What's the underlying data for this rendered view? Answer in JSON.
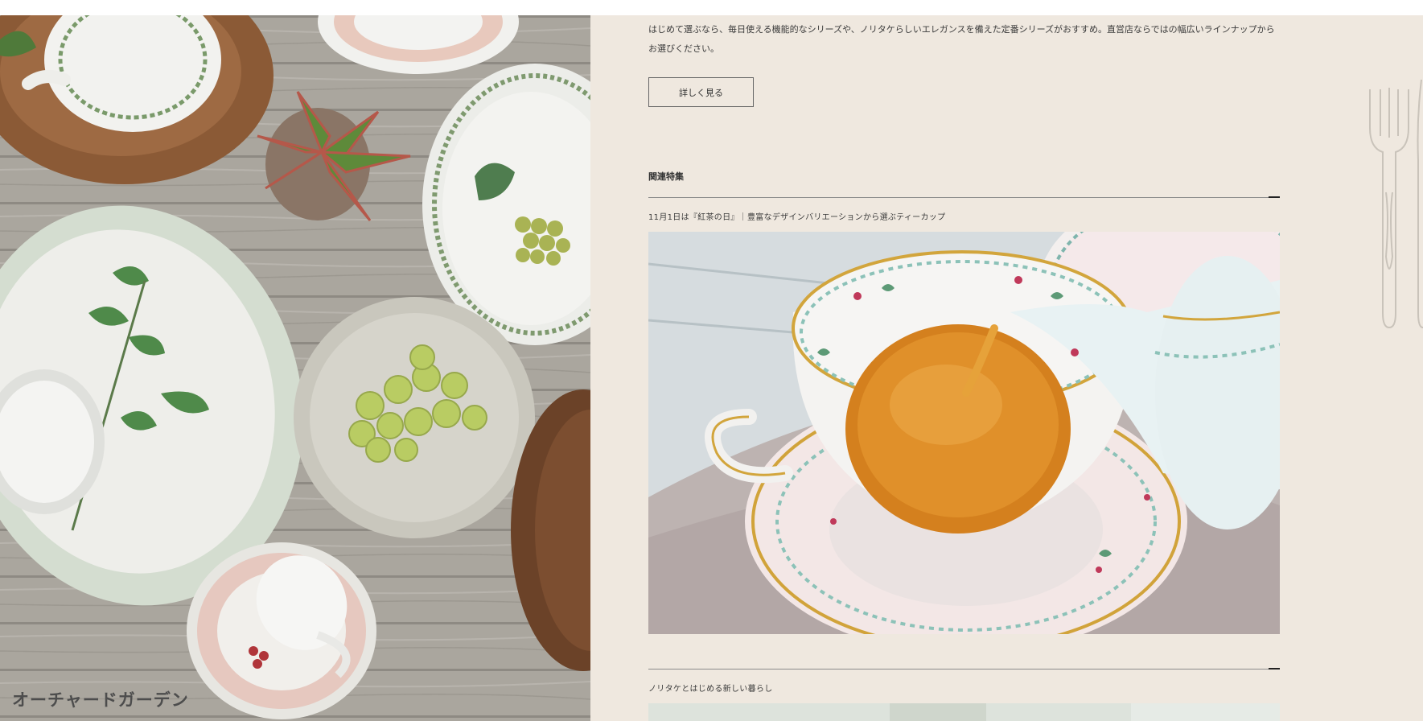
{
  "left_photo": {
    "series_name": "オーチャードガーデン"
  },
  "main": {
    "intro_text": "はじめて選ぶなら、毎日使える機能的なシリーズや、ノリタケらしいエレガンスを備えた定番シリーズがおすすめ。直営店ならではの幅広いラインナップからお選びください。",
    "more_button_label": "詳しく見る",
    "related_heading": "関連特集",
    "features": [
      {
        "caption": "11月1日は『紅茶の日』｜豊富なデザインバリエーションから選ぶティーカップ"
      },
      {
        "caption": "ノリタケとはじめる新しい暮らし"
      }
    ]
  },
  "colors": {
    "panel_background": "#efe8df",
    "text": "#333333",
    "rule": "#8a8a8a"
  }
}
